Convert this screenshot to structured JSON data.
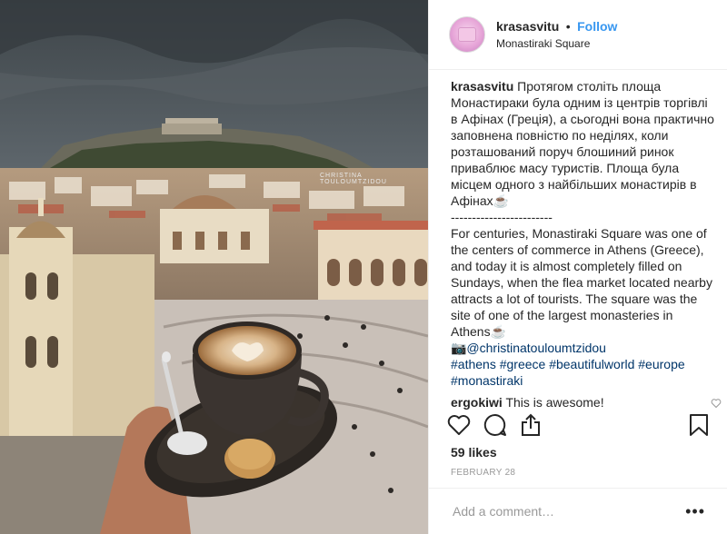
{
  "header": {
    "username": "krasasvitu",
    "separator": "•",
    "follow_label": "Follow",
    "location": "Monastiraki Square"
  },
  "photo": {
    "watermark": "CHRISTINA TOULOUMTZIDOU"
  },
  "caption": {
    "username": "krasasvitu",
    "text_ua": "Протягом століть площа Монастираки була одним із центрів торгівлі в Афінах (Греція), а сьогодні вона практично заповнена повністю по неділях, коли розташований поруч блошиний ринок приваблює масу туристів. Площа була місцем одного з найбільших монастирів в Афінах☕",
    "divider": "------------------------",
    "text_en": "For centuries, Monastiraki Square was one of the centers of commerce in Athens (Greece), and today it is almost completely filled on Sundays, when the flea market located nearby attracts a lot of tourists. The square was the site of one of the largest monasteries in Athens☕",
    "credit": "📷@christinatouloumtzidou",
    "hashtags": [
      "#athens",
      "#greece",
      "#beautifulworld",
      "#europe",
      "#monastiraki"
    ]
  },
  "comment": {
    "username": "ergokiwi",
    "text": "This is awesome!"
  },
  "actions": {
    "like_icon": "heart-outline-icon",
    "comment_icon": "speech-bubble-icon",
    "share_icon": "share-upload-icon",
    "save_icon": "bookmark-icon"
  },
  "likes": "59 likes",
  "date": "FEBRUARY 28",
  "add_comment": {
    "placeholder": "Add a comment…",
    "more": "•••"
  },
  "colors": {
    "link": "#003569",
    "follow": "#3897f0",
    "muted": "#999999"
  }
}
